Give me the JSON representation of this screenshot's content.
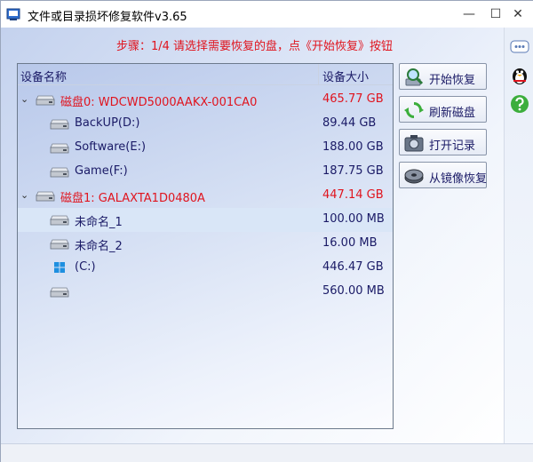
{
  "window": {
    "title": "文件或目录损坏修复软件v3.65",
    "minimize_glyph": "—",
    "maximize_glyph": "☐",
    "close_glyph": "✕"
  },
  "step_text": "步骤：1/4 请选择需要恢复的盘，点《开始恢复》按钮",
  "tree": {
    "columns": {
      "name": "设备名称",
      "size": "设备大小"
    },
    "rows": [
      {
        "type": "disk",
        "label": "磁盘0: WDCWD5000AAKX-001CA0",
        "size": "465.77 GB",
        "icon": "hard-disk-icon",
        "expanded": true
      },
      {
        "type": "part",
        "label": "BackUP(D:)",
        "size": "89.44 GB",
        "icon": "drive-icon"
      },
      {
        "type": "part",
        "label": "Software(E:)",
        "size": "188.00 GB",
        "icon": "drive-icon"
      },
      {
        "type": "part",
        "label": "Game(F:)",
        "size": "187.75 GB",
        "icon": "drive-icon"
      },
      {
        "type": "disk",
        "label": "磁盘1: GALAXTA1D0480A",
        "size": "447.14 GB",
        "icon": "hard-disk-icon",
        "expanded": true
      },
      {
        "type": "part",
        "label": "未命名_1",
        "size": "100.00 MB",
        "icon": "drive-icon",
        "selected": true
      },
      {
        "type": "part",
        "label": "未命名_2",
        "size": "16.00 MB",
        "icon": "drive-icon"
      },
      {
        "type": "part",
        "label": "(C:)",
        "size": "446.47 GB",
        "icon": "windows-logo-icon"
      },
      {
        "type": "part",
        "label": "",
        "size": "560.00 MB",
        "icon": "drive-icon"
      }
    ]
  },
  "buttons": {
    "start_recover": "开始恢复",
    "refresh_disk": "刷新磁盘",
    "open_log": "打开记录",
    "recover_from_image": "从镜像恢复"
  },
  "colors": {
    "accent_red": "#e0141e",
    "text_navy": "#1a1a66",
    "selection": "#d9e6f7"
  }
}
